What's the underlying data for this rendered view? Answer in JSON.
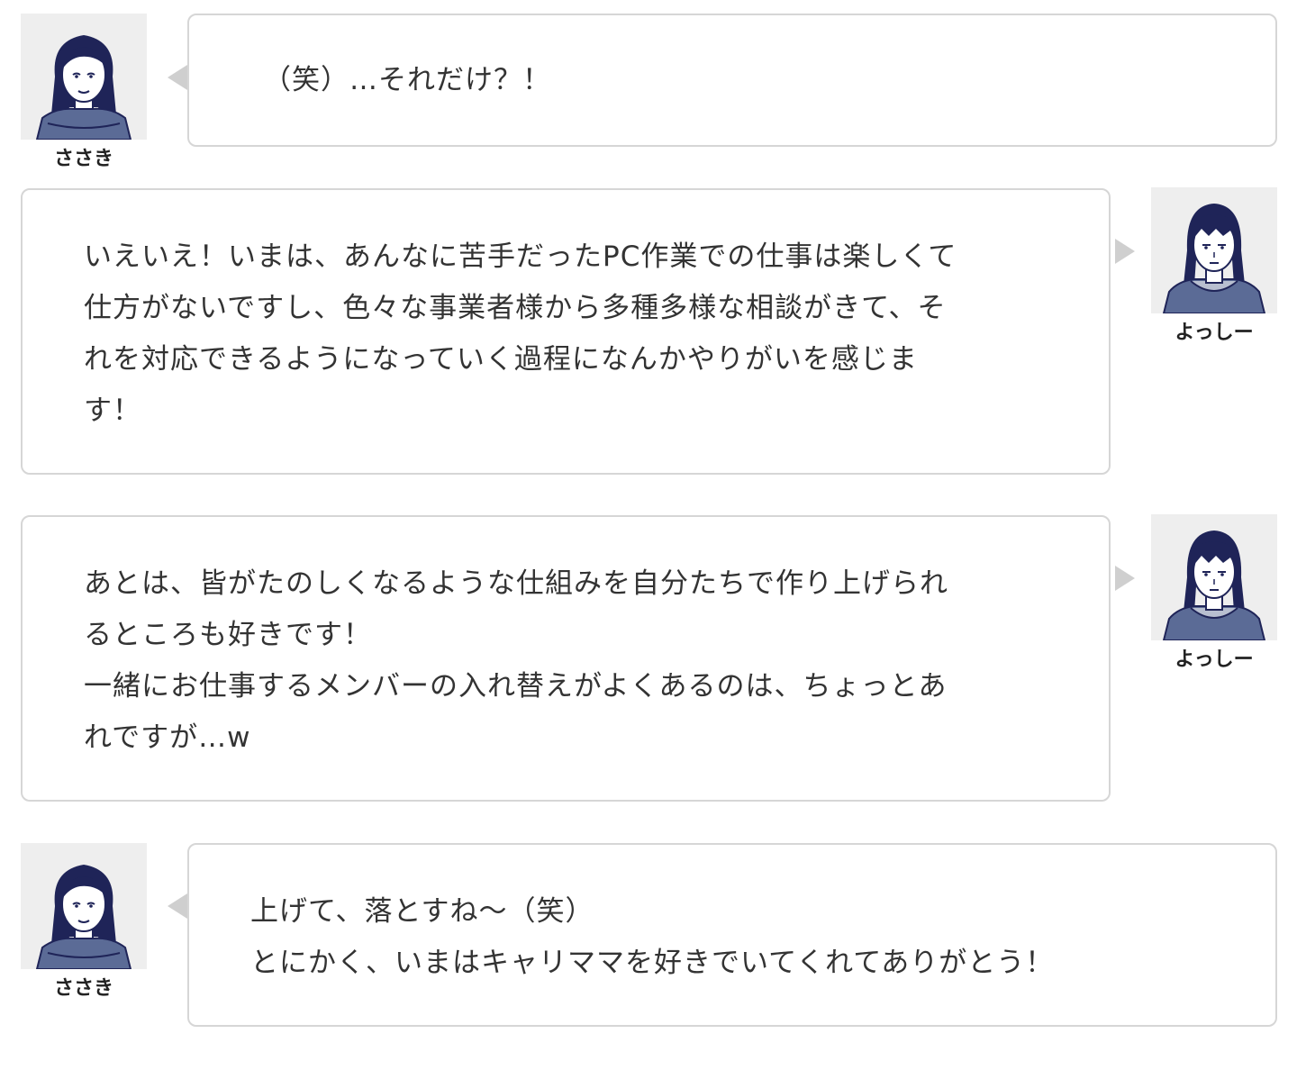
{
  "conversation": [
    {
      "speaker": "ささき",
      "text": "（笑）…それだけ？！"
    },
    {
      "speaker": "よっしー",
      "text": "いえいえ！いまは、あんなに苦手だったPC作業での仕事は楽しくて\n仕方がないですし、色々な事業者様から多種多様な相談がきて、そ\nれを対応できるようになっていく過程になんかやりがいを感じま\nす！"
    },
    {
      "speaker": "よっしー",
      "text": "あとは、皆がたのしくなるような仕組みを自分たちで作り上げられ\nるところも好きです！\n一緒にお仕事するメンバーの入れ替えがよくあるのは、ちょっとあ\nれですが…w"
    },
    {
      "speaker": "ささき",
      "text": "上げて、落とすね～（笑）\nとにかく、いまはキャリママを好きでいてくれてありがとう！"
    }
  ],
  "colors": {
    "bubble_border": "#d6d6d6",
    "tail": "#cfcfcf",
    "avatar_bg": "#eeeeee",
    "avatar_line": "#1f2458",
    "avatar_clothes": "#5b6b96"
  },
  "icons": {
    "sasaki_avatar": "woman-avatar-icon",
    "yossy_avatar": "man-avatar-icon"
  }
}
